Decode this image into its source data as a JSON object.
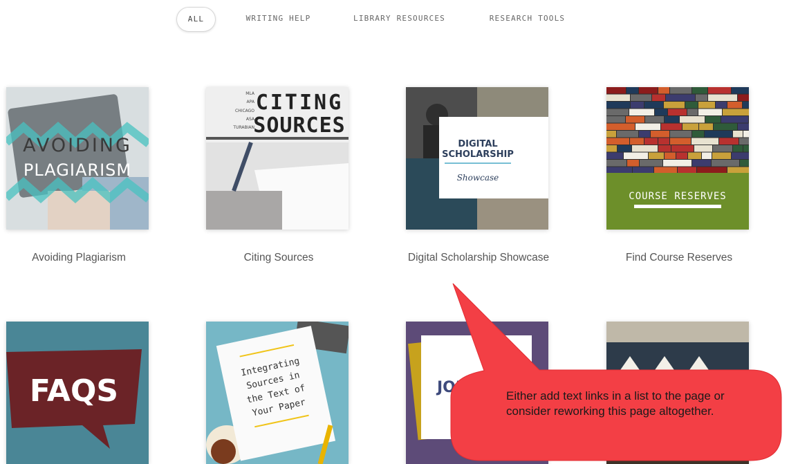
{
  "filters": {
    "all": "ALL",
    "writing_help": "WRITING HELP",
    "library_resources": "LIBRARY RESOURCES",
    "research_tools": "RESEARCH TOOLS"
  },
  "cards": [
    {
      "label": "Avoiding Plagiarism",
      "image_text": [
        "AVOIDING",
        "PLAGIARISM"
      ]
    },
    {
      "label": "Citing Sources",
      "image_text": [
        "CITING",
        "SOURCES",
        "MLA",
        "APA",
        "CHICAGO",
        "ASA",
        "TURABIAN"
      ]
    },
    {
      "label": "Digital Scholarship Showcase",
      "image_text": [
        "DIGITAL",
        "SCHOLARSHIP",
        "Showcase"
      ]
    },
    {
      "label": "Find Course Reserves",
      "image_text": [
        "COURSE RESERVES"
      ]
    },
    {
      "label": "",
      "image_text": [
        "FAQS"
      ]
    },
    {
      "label": "",
      "image_text": [
        "Integrating",
        "Sources in",
        "the Text of",
        "Your Paper"
      ]
    },
    {
      "label": "",
      "image_text": [
        "JOU"
      ]
    },
    {
      "label": "",
      "image_text": []
    }
  ],
  "callout": {
    "text": "Either add text links in a list to the page or consider reworking this page altogether.",
    "color": "#f33f45"
  },
  "colors": {
    "active_border": "#d6d6d6",
    "label": "#555555"
  }
}
